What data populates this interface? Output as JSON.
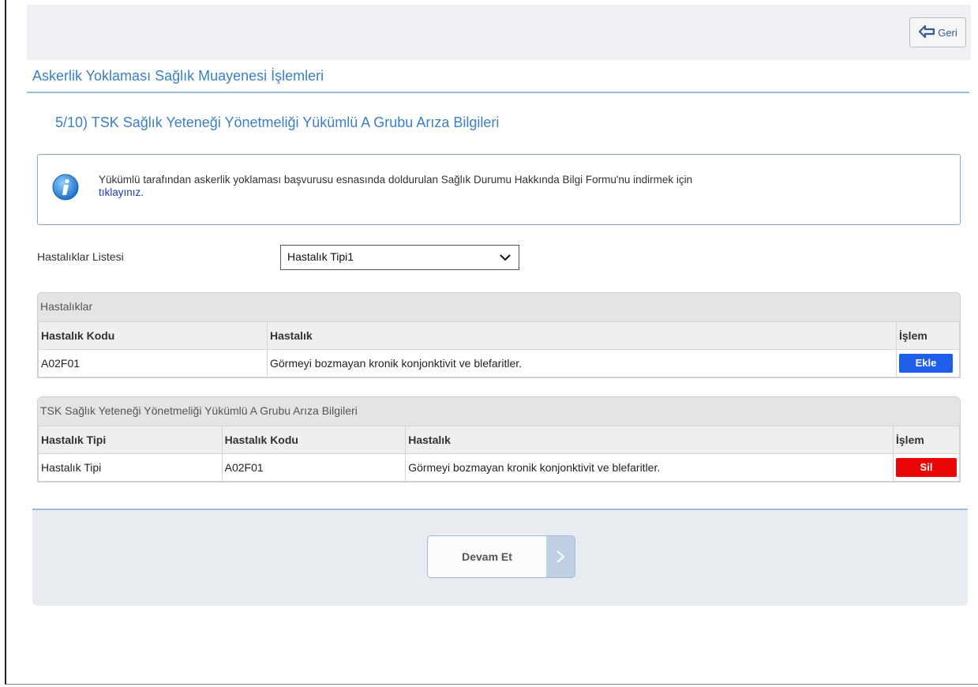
{
  "header": {
    "back_label": "Geri"
  },
  "page_title": "Askerlik Yoklaması Sağlık Muayenesi İşlemleri",
  "step_title": "5/10) TSK Sağlık Yeteneği Yönetmeliği Yükümlü A Grubu Arıza Bilgileri",
  "info": {
    "text": "Yükümlü tarafından askerlik yoklaması başvurusu esnasında doldurulan Sağlık Durumu Hakkında Bilgi Formu'nu indirmek için",
    "link_label": "tıklayınız",
    "suffix": "."
  },
  "filter": {
    "label": "Hastalıklar Listesi",
    "selected": "Hastalık Tipi1"
  },
  "diseases_table": {
    "title": "Hastalıklar",
    "headers": [
      "Hastalık Kodu",
      "Hastalık",
      "İşlem"
    ],
    "rows": [
      {
        "code": "A02F01",
        "name": "Görmeyi bozmayan kronik konjonktivit ve blefaritler.",
        "action": "Ekle"
      }
    ]
  },
  "selected_table": {
    "title": "TSK Sağlık Yeteneği Yönetmeliği Yükümlü A Grubu Arıza Bilgileri",
    "headers": [
      "Hastalık Tipi",
      "Hastalık Kodu",
      "Hastalık",
      "İşlem"
    ],
    "rows": [
      {
        "type": "Hastalık Tipi",
        "code": "A02F01",
        "name": "Görmeyi bozmayan kronik konjonktivit ve blefaritler.",
        "action": "Sil"
      }
    ]
  },
  "footer": {
    "next_label": "Devam Et"
  },
  "colors": {
    "accent": "#3b7fc4",
    "add_button": "#1f5ee8",
    "delete_button": "#e80606",
    "link": "#1a3fb0"
  }
}
